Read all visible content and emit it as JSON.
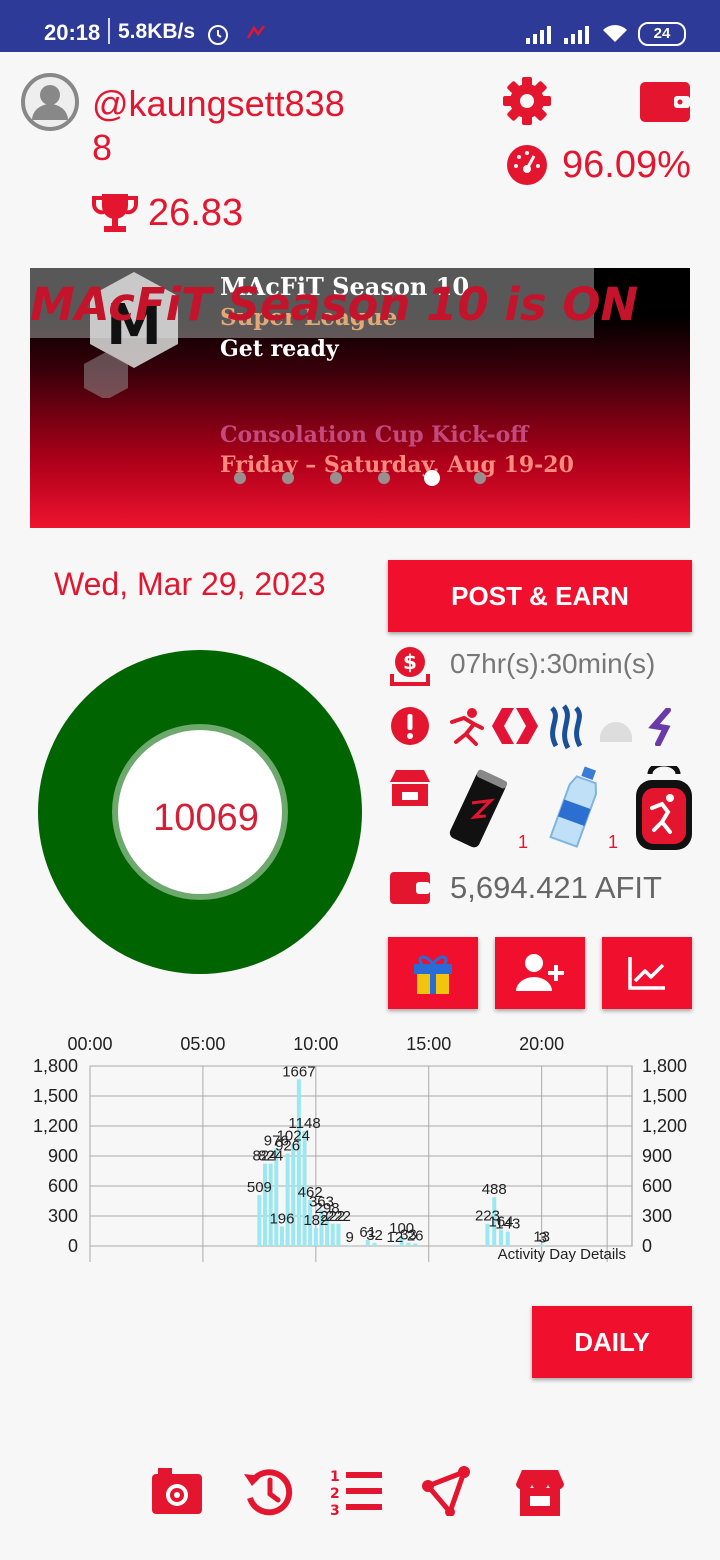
{
  "status_bar": {
    "time": "20:18",
    "network_speed": "5.8KB/s",
    "battery": "24"
  },
  "header": {
    "username_line1": "@kaungsett838",
    "username_line2": "8",
    "trophy_score": "26.83",
    "percent": "96.09%"
  },
  "banner": {
    "title": "MAcFiT Season 10",
    "subtitle": "Super League",
    "line3": "Get ready",
    "overlay_text": "MAcFiT Season 10 is ON",
    "line4": "Consolation Cup Kick-off",
    "line5": "Friday – Saturday, Aug 19-20",
    "page_count": 6,
    "active_page": 4
  },
  "date": "Wed, Mar 29, 2023",
  "steps": "10069",
  "post_earn_label": "POST & EARN",
  "timer": "07hr(s):30min(s)",
  "shop": {
    "item1_count": "1",
    "item2_count": "1"
  },
  "afit_balance": "5,694.421 AFIT",
  "chart_data": {
    "type": "bar",
    "x_tick_labels": [
      "00:00",
      "05:00",
      "10:00",
      "15:00",
      "20:00"
    ],
    "y_tick_labels": [
      "1,800",
      "1,500",
      "1,200",
      "900",
      "600",
      "300",
      "0"
    ],
    "ylim": [
      0,
      1800
    ],
    "xlim_hours": [
      0,
      24
    ],
    "legend": "Activity Day Details",
    "bars": [
      {
        "x": 7.5,
        "value": 509
      },
      {
        "x": 7.75,
        "value": 824
      },
      {
        "x": 8.0,
        "value": 824
      },
      {
        "x": 8.25,
        "value": 976
      },
      {
        "x": 8.5,
        "value": 196
      },
      {
        "x": 8.75,
        "value": 926
      },
      {
        "x": 9.0,
        "value": 1024
      },
      {
        "x": 9.25,
        "value": 1667
      },
      {
        "x": 9.5,
        "value": 1148
      },
      {
        "x": 9.75,
        "value": 462
      },
      {
        "x": 10.0,
        "value": 182
      },
      {
        "x": 10.25,
        "value": 363
      },
      {
        "x": 10.5,
        "value": 298
      },
      {
        "x": 10.75,
        "value": 222
      },
      {
        "x": 11.0,
        "value": 222
      },
      {
        "x": 11.5,
        "value": 9
      },
      {
        "x": 12.3,
        "value": 61
      },
      {
        "x": 12.6,
        "value": 32
      },
      {
        "x": 13.5,
        "value": 12
      },
      {
        "x": 13.8,
        "value": 100
      },
      {
        "x": 14.1,
        "value": 33
      },
      {
        "x": 14.4,
        "value": 26
      },
      {
        "x": 17.6,
        "value": 223
      },
      {
        "x": 17.9,
        "value": 488
      },
      {
        "x": 18.2,
        "value": 164
      },
      {
        "x": 18.5,
        "value": 143
      },
      {
        "x": 20.0,
        "value": 13
      },
      {
        "x": 20.05,
        "value": 3
      }
    ]
  },
  "daily_label": "DAILY",
  "colors": {
    "accent": "#f0102e",
    "ring": "#006400",
    "bar": "#9be8f0",
    "status_bar": "#2e3a98"
  }
}
